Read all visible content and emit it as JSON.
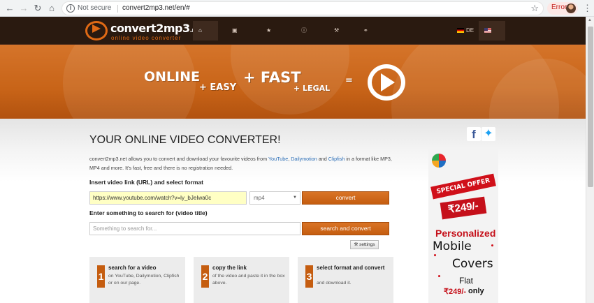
{
  "browser": {
    "security_label": "Not secure",
    "url": "convert2mp3.net/en/#",
    "error_label": "Error"
  },
  "site": {
    "logo_name": "convert2mp3",
    "logo_tld": ".net",
    "logo_tagline": "online video converter"
  },
  "menu": [
    {
      "label": "home",
      "icon": "home-icon"
    },
    {
      "label": "addon",
      "icon": "puzzle-icon"
    },
    {
      "label": "charts",
      "icon": "star-icon"
    },
    {
      "label": "infos",
      "icon": "info-icon"
    },
    {
      "label": "tools",
      "icon": "wrench-icon"
    },
    {
      "label": "link-us",
      "icon": "link-icon"
    }
  ],
  "languages": [
    {
      "label": "DE"
    },
    {
      "label": "EN"
    }
  ],
  "hero": {
    "online": "ONLINE",
    "easy": "+ EASY",
    "fast": "+ FAST",
    "legal": "+ LEGAL",
    "equals": "="
  },
  "converter": {
    "title": "YOUR ONLINE VIDEO CONVERTER!",
    "intro_before": "convert2mp3.net allows you to convert and download your favourite videos from ",
    "link_youtube": "YouTube",
    "comma": ", ",
    "link_dailymotion": "Dailymotion",
    "and": " and ",
    "link_clipfish": "Clipfish",
    "intro_after": " in a format like MP3, MP4 and more. It's fast, free and there is no registration needed.",
    "url_label": "Insert video link (URL) and select format",
    "url_value": "https://www.youtube.com/watch?v=ly_bJeIwa0c",
    "format_value": "mp4",
    "convert_label": "convert",
    "search_label": "Enter something to search for (video title)",
    "search_placeholder": "Something to search for...",
    "search_button": "search and convert",
    "settings_label": "settings"
  },
  "steps": [
    {
      "number": "1",
      "title": "search for a video",
      "desc": "on YouTube, Dailymotion, Clipfish or on our page."
    },
    {
      "number": "2",
      "title": "copy the link",
      "desc": "of the video and paste it in the box above."
    },
    {
      "number": "3",
      "title": "select format and convert",
      "desc": "and download it."
    }
  ],
  "ad": {
    "special_offer": "SPECIAL OFFER",
    "price": "₹249/-",
    "personalized": "Personalized",
    "mobile": "Mobile",
    "covers": "Covers",
    "flat": "Flat",
    "price2": "₹249/-",
    "only": "only"
  },
  "colors": {
    "accent": "#c55d10",
    "nav_bg": "#2a1a10",
    "link": "#2a6db6"
  }
}
